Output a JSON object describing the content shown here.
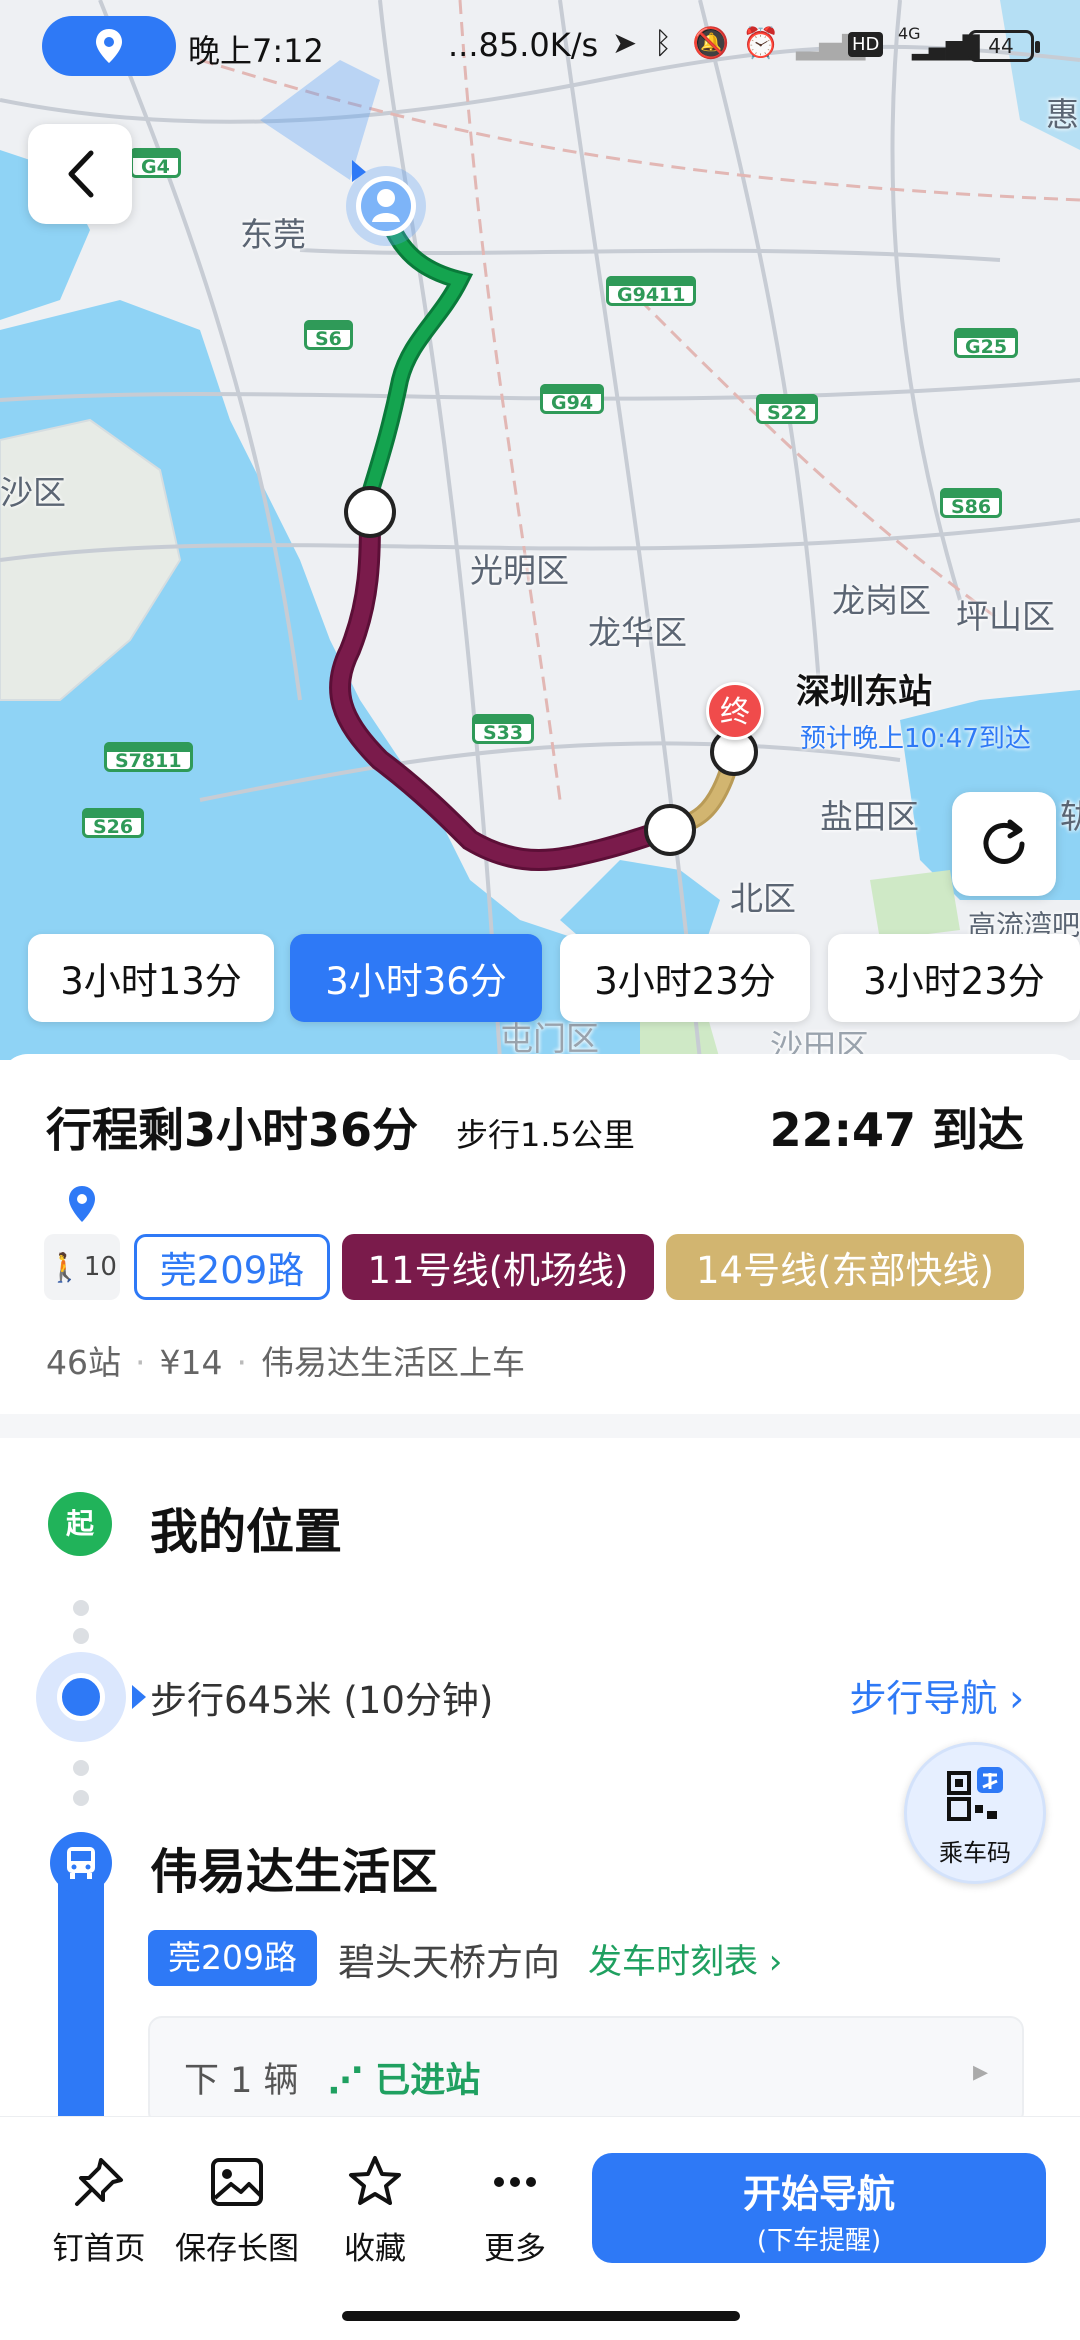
{
  "status_bar": {
    "time": "晚上7:12",
    "net_speed": "...85.0K/s",
    "hd": "HD",
    "network": "4G",
    "battery": "44"
  },
  "map": {
    "labels": {
      "dongguan": "东莞",
      "shaqu": "沙区",
      "guangming": "光明区",
      "longhua": "龙华区",
      "longgang": "龙岗区",
      "pingshan": "坪山区",
      "yantian": "盐田区",
      "beiqu": "北区",
      "gaoliu": "高流湾吧",
      "hui": "惠",
      "tian": "轨",
      "bottom_a": "屯门区",
      "bottom_b": "沙田区"
    },
    "highways": {
      "g4": "G4",
      "s6": "S6",
      "g9411": "G9411",
      "g25": "G25",
      "g94": "G94",
      "s22": "S22",
      "s86": "S86",
      "s33": "S33",
      "s7811": "S7811",
      "s26": "S26"
    },
    "destination": {
      "marker": "终",
      "name": "深圳东站",
      "eta": "预计晚上10:47到达"
    }
  },
  "route_options": [
    "3小时13分",
    "3小时36分",
    "3小时23分",
    "3小时23分"
  ],
  "trip": {
    "title": "行程剩3小时36分",
    "walk_distance": "步行1.5公里",
    "arrive": "22:47 到达",
    "walk_chip": "10",
    "lines": {
      "bus": "莞209路",
      "metro11": "11号线(机场线)",
      "metro14": "14号线(东部快线)"
    },
    "summary": {
      "stations": "46站",
      "price": "¥14",
      "board": "伟易达生活区上车"
    }
  },
  "steps": {
    "start_badge": "起",
    "start_title": "我的位置",
    "walk_text": "步行645米 (10分钟)",
    "walk_nav": "步行导航 ›",
    "stop_title": "伟易达生活区",
    "bus_chip": "莞209路",
    "direction": "碧头天桥方向",
    "timetable": "发车时刻表 ›",
    "next_label": "下 1 辆",
    "arrived": "已进站",
    "qr_label": "乘车码"
  },
  "bottom_bar": {
    "pin": "钉首页",
    "save": "保存长图",
    "fav": "收藏",
    "more": "更多",
    "start_nav": "开始导航",
    "start_nav_sub": "(下车提醒)"
  },
  "colors": {
    "accent": "#2e79f6",
    "walk_green": "#1fa060",
    "metro11": "#7a1b4b",
    "metro14": "#d2b570",
    "route_green": "#12a04f"
  }
}
